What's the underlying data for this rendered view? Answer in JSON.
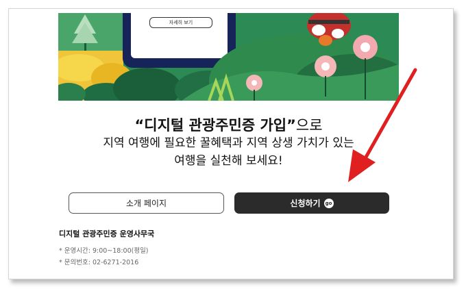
{
  "banner": {
    "card_button_label": "자세히 보기"
  },
  "headline": {
    "quote_open": "“",
    "title": "디지털 관광주민증 가입",
    "quote_close": "”",
    "suffix": "으로",
    "line2": "지역 여행에 필요한 꿀혜택과 지역 상생 가치가 있는",
    "line3": "여행을 실천해 보세요!"
  },
  "buttons": {
    "intro_label": "소개 페이지",
    "apply_label": "신청하기",
    "go_badge": "go"
  },
  "office": {
    "title": "디지털 관광주민증 운영사무국",
    "hours": "* 운영시간: 9:00~18:00(평일)",
    "phone": "* 문의번호: 02-6271-2016"
  },
  "colors": {
    "apply_button_bg": "#2b2b2b",
    "annotation_arrow": "#e02020",
    "banner_green": "#2f8a4e",
    "banner_yellow": "#f2c230"
  }
}
